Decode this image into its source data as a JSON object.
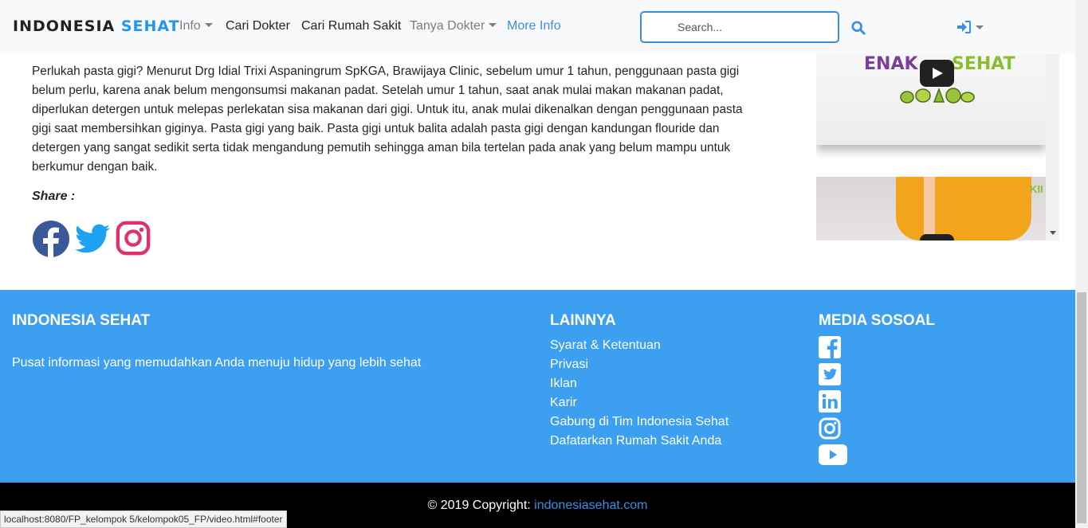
{
  "navbar": {
    "brand_part1": "INDONESIA",
    "brand_part2": "SEHAT",
    "links": [
      {
        "label": "Info"
      },
      {
        "label": "Cari Dokter"
      },
      {
        "label": "Cari Rumah Sakit"
      },
      {
        "label": "Tanya Dokter"
      },
      {
        "label": "More Info"
      }
    ],
    "search_placeholder": "Search..."
  },
  "article": {
    "paragraph": "Perlukah pasta gigi? Menurut Drg Idial Trixi Aspaningrum SpKGA, Brawijaya Clinic, sebelum umur 1 tahun, penggunaan pasta gigi belum perlu, karena anak belum mengonsumsi makanan padat. Setelah umur 1 tahun, saat anak mulai makan makanan padat, diperlukan detergen untuk melepas perlekatan sisa makanan dari gigi. Untuk itu, anak mulai dikenalkan dengan penggunaan pasta gigi saat membersihkan giginya. Pasta gigi yang baik. Pasta gigi untuk balita adalah pasta gigi dengan kandungan flouride dan detergen yang sangat sedikit serta tidak mengandung pemutih sehingga aman bila tertelan pada anak yang belum mampu untuk berkumur dengan baik.",
    "share_label": "Share :"
  },
  "videos": {
    "v1_text_left": "ENAK",
    "v1_text_right": "SEHAT",
    "v2_logo": "KII"
  },
  "footer": {
    "brand_title": "INDONESIA SEHAT",
    "brand_desc": "Pusat informasi yang memudahkan Anda menuju hidup yang lebih sehat",
    "links_title": "LAINNYA",
    "links": [
      "Syarat & Ketentuan",
      "Privasi",
      "Iklan",
      "Karir",
      "Gabung di Tim Indonesia Sehat",
      "Dafatarkan Rumah Sakit Anda"
    ],
    "social_title": "MEDIA SOSOAL",
    "copyright_prefix": "© 2019 Copyright:",
    "copyright_link": "indonesiasehat.com"
  },
  "status_url": "localhost:8080/FP_kelompok 5/kelompok05_FP/video.html#footer",
  "colors": {
    "accent": "#3a8ee6",
    "footer_bg": "#3d9ff0",
    "facebook": "#3b5998",
    "twitter": "#1da1f2",
    "instagram": "#e1306c"
  }
}
